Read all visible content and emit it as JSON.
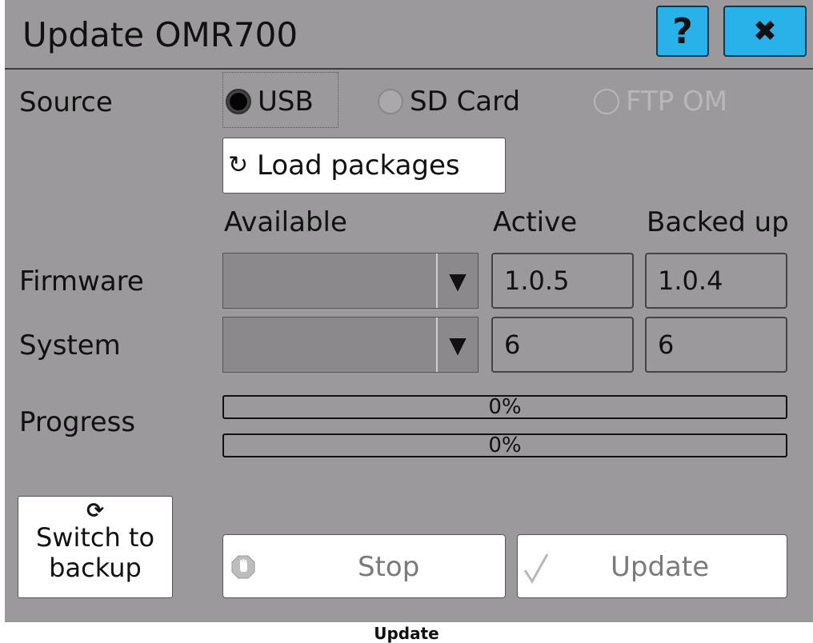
{
  "window": {
    "title": "Update OMR700",
    "help_label": "?",
    "close_label": "✖"
  },
  "source": {
    "label": "Source",
    "options": [
      {
        "label": "USB",
        "state": "selected"
      },
      {
        "label": "SD Card",
        "state": "unselected"
      },
      {
        "label": "FTP OM",
        "state": "disabled"
      }
    ]
  },
  "load_packages": {
    "icon": "↻",
    "label": "Load packages"
  },
  "columns": {
    "available": "Available",
    "active": "Active",
    "backed_up": "Backed up"
  },
  "rows": [
    {
      "label": "Firmware",
      "available": "",
      "active": "1.0.5",
      "backed_up": "1.0.4"
    },
    {
      "label": "System",
      "available": "",
      "active": "6",
      "backed_up": "6"
    }
  ],
  "progress": {
    "label": "Progress",
    "bars": [
      {
        "value": 0,
        "text": "0%"
      },
      {
        "value": 0,
        "text": "0%"
      }
    ]
  },
  "buttons": {
    "switch_icon": "⟳",
    "switch_line1": "Switch to",
    "switch_line2": "backup",
    "stop": "Stop",
    "update": "Update"
  },
  "caption": "Update",
  "colors": {
    "panel": "#9b999b",
    "accent": "#29b2ea",
    "disabled_text": "#777777"
  }
}
